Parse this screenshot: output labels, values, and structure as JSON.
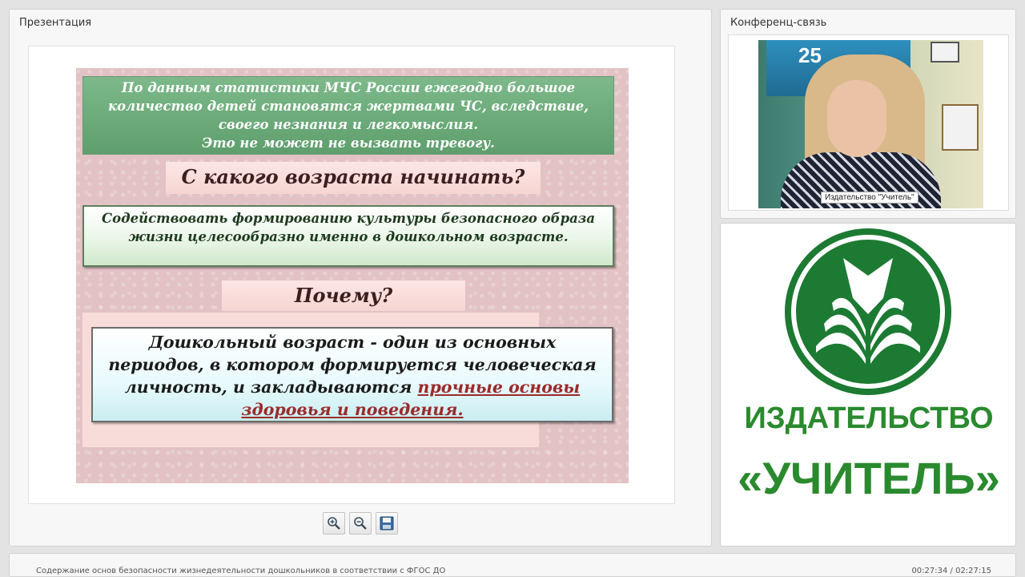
{
  "presentation": {
    "title": "Презентация",
    "slide": {
      "stats_text": "По данным статистики МЧС России ежегодно большое количество детей становятся жертвами ЧС, вследствие, своего незнания и легкомыслия.",
      "stats_text2": "Это не может не вызвать тревогу.",
      "heading_age": "С какого возраста начинать?",
      "culture_text": "Содействовать формированию культуры безопасного образа жизни целесообразно именно в дошкольном возрасте.",
      "heading_why": "Почему?",
      "preschool_text": "Дошкольный возраст - один из основных периодов, в котором формируется человеческая личность, и закладываются",
      "preschool_highlight": "прочные основы здоровья и поведения."
    },
    "toolbar": {
      "zoom_in_icon": "zoom-in-icon",
      "zoom_out_icon": "zoom-out-icon",
      "save_icon": "save-icon"
    }
  },
  "conference": {
    "title": "Конференц-связь",
    "video_caption": "Издательство \"Учитель\"",
    "sign_text": "25"
  },
  "logo": {
    "line1": "ИЗДАТЕЛЬСТВО",
    "line2": "«УЧИТЕЛЬ»",
    "brand_color": "#2a8a2e"
  },
  "footer": {
    "title": "Содержание основ безопасности жизнедеятельности дошкольников в соответствии с ФГОС ДО",
    "time": "00:27:34 / 02:27:15"
  }
}
